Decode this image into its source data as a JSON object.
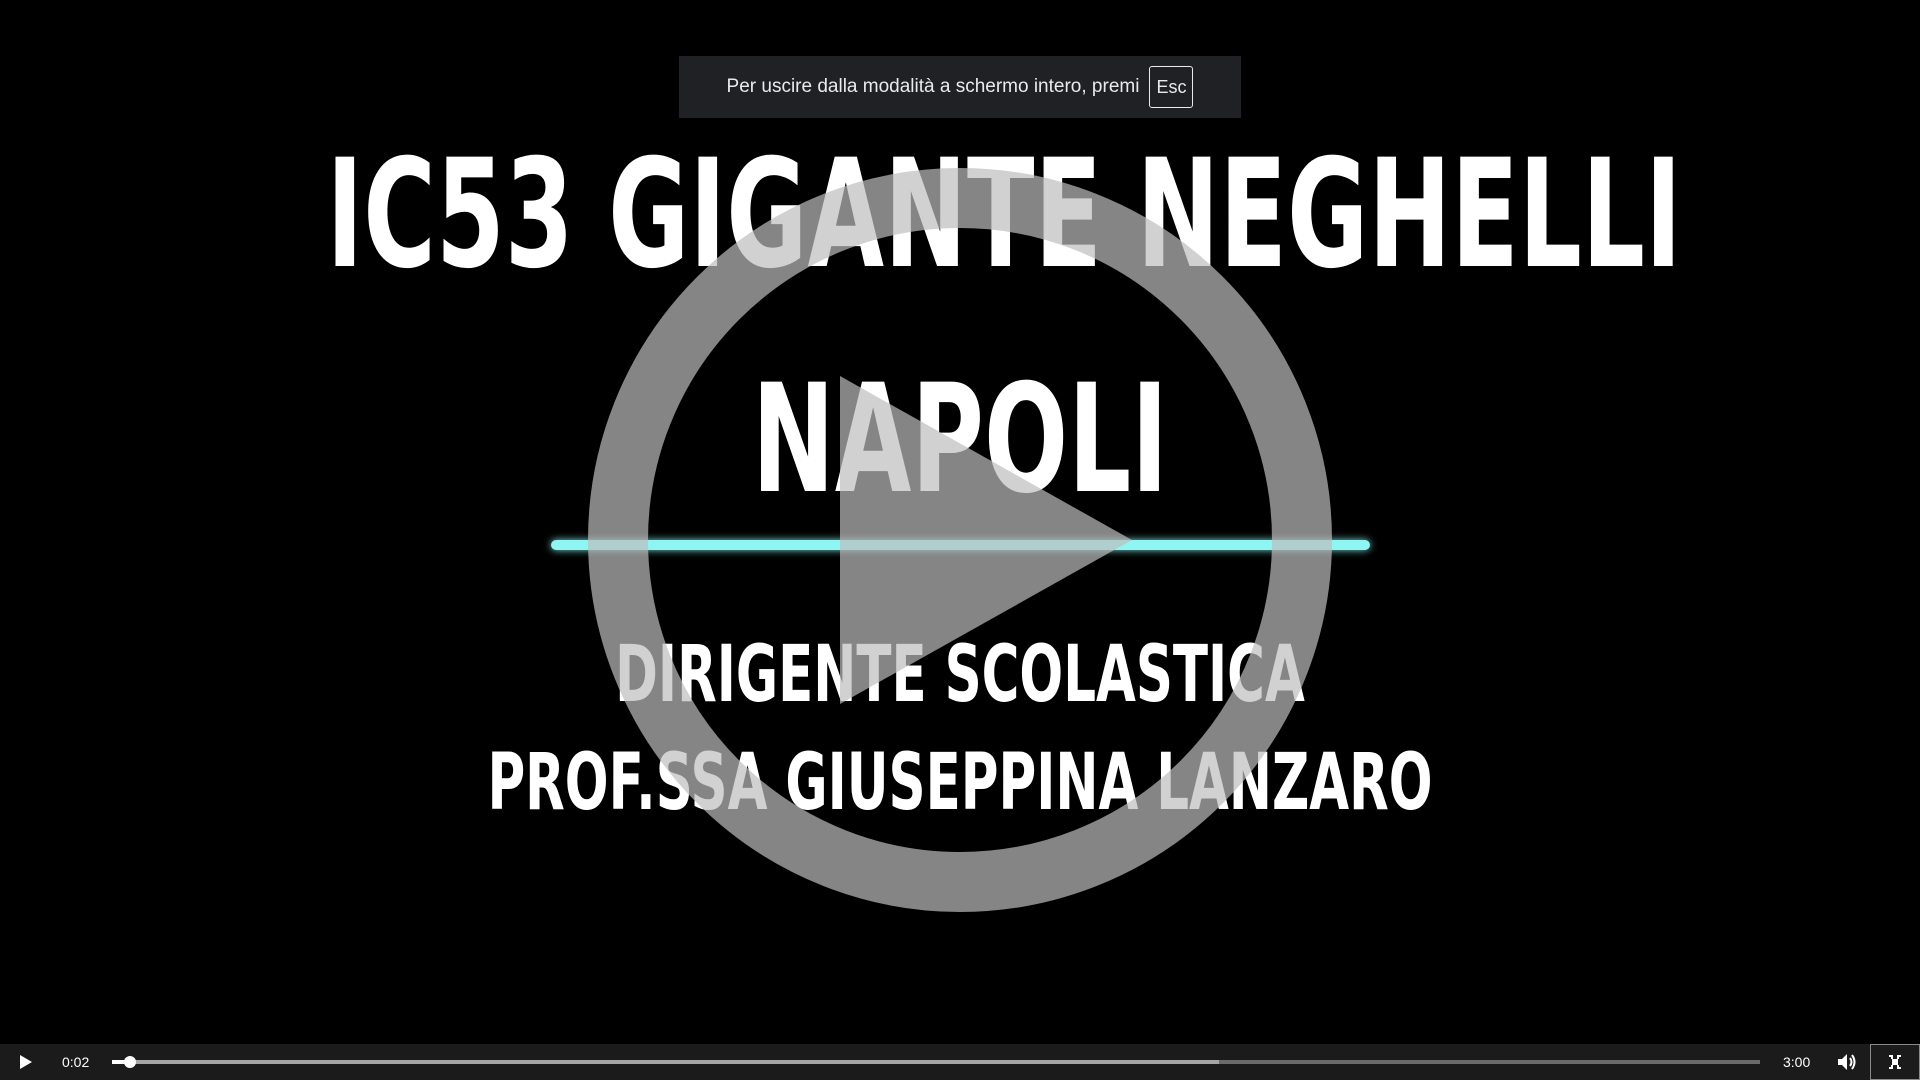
{
  "video": {
    "title_line1": "IC53 GIGANTE NEGHELLI",
    "title_line2": "NAPOLI",
    "subtitle_line1": "DIRIGENTE SCOLASTICA",
    "subtitle_line2": "PROF.SSA GIUSEPPINA LANZARO"
  },
  "fullscreen_notice": {
    "text": "Per uscire dalla modalità a schermo intero, premi",
    "key": "Esc"
  },
  "controls": {
    "current_time": "0:02",
    "duration": "3:00",
    "played_fraction": 0.011,
    "buffered_fraction": 0.672,
    "icons": {
      "play": "play-icon",
      "big_play": "big-play-icon",
      "volume": "volume-icon",
      "exit_fullscreen": "exit-fullscreen-icon"
    }
  },
  "colors": {
    "background": "#000000",
    "accent_underline": "#8ff5f2",
    "control_bar": "#1b1b1b",
    "banner": "#202124"
  }
}
